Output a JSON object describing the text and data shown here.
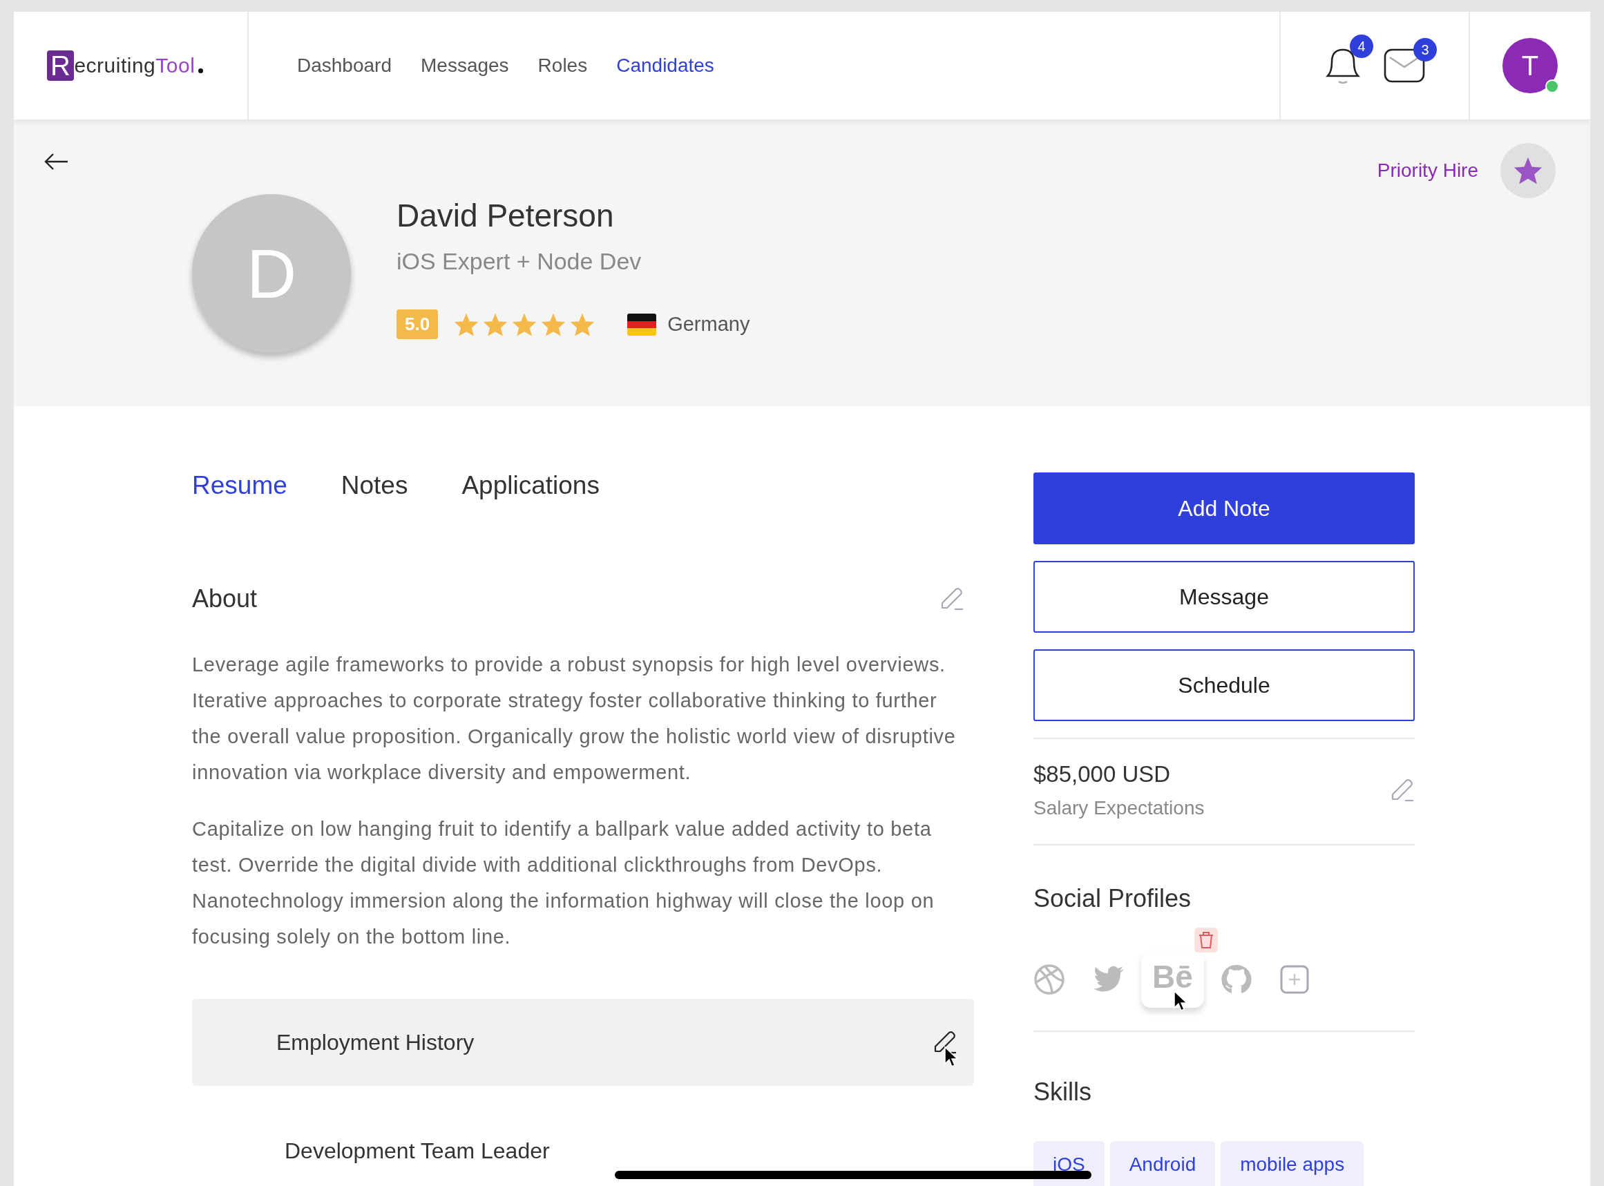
{
  "logo": {
    "initial": "R",
    "rest": "ecruiting",
    "accent": "Tool"
  },
  "nav": [
    {
      "label": "Dashboard",
      "selected": false
    },
    {
      "label": "Messages",
      "selected": false
    },
    {
      "label": "Roles",
      "selected": false
    },
    {
      "label": "Candidates",
      "selected": true
    }
  ],
  "notifications": {
    "count": "4"
  },
  "messages": {
    "count": "3"
  },
  "user": {
    "initial": "T",
    "online": true
  },
  "priority": {
    "label": "Priority Hire"
  },
  "candidate": {
    "initial": "D",
    "name": "David Peterson",
    "title": "iOS Expert + Node Dev",
    "rating": "5.0",
    "stars": 5,
    "country": "Germany"
  },
  "tabs": [
    {
      "label": "Resume",
      "selected": true
    },
    {
      "label": "Notes",
      "selected": false
    },
    {
      "label": "Applications",
      "selected": false
    }
  ],
  "about": {
    "title": "About",
    "paragraphs": [
      "Leverage agile frameworks to provide a robust synopsis for high level overviews. Iterative approaches to corporate strategy foster collaborative thinking to further the overall value proposition. Organically grow the holistic world view of disruptive innovation via workplace diversity and empowerment.",
      "Capitalize on low hanging fruit to identify a ballpark value added activity to beta test. Override the digital divide with additional clickthroughs from DevOps. Nanotechnology immersion along the information highway will close the loop on focusing solely on the bottom line."
    ]
  },
  "employment": {
    "title": "Employment History",
    "jobs": [
      {
        "role": "Development Team Leader"
      }
    ]
  },
  "actions": [
    {
      "label": "Add Note",
      "kind": "primary"
    },
    {
      "label": "Message",
      "kind": "outline"
    },
    {
      "label": "Schedule",
      "kind": "outline"
    }
  ],
  "salary": {
    "value": "$85,000 USD",
    "label": "Salary Expectations"
  },
  "social": {
    "title": "Social Profiles",
    "profiles": [
      {
        "kind": "ball",
        "hovered": false
      },
      {
        "kind": "bird",
        "hovered": false
      },
      {
        "kind": "text",
        "label": "Bē",
        "hovered": true
      },
      {
        "kind": "cat",
        "hovered": false
      },
      {
        "kind": "add",
        "hovered": false
      }
    ]
  },
  "skills": {
    "title": "Skills",
    "items": [
      "iOS",
      "Android",
      "mobile apps"
    ]
  }
}
